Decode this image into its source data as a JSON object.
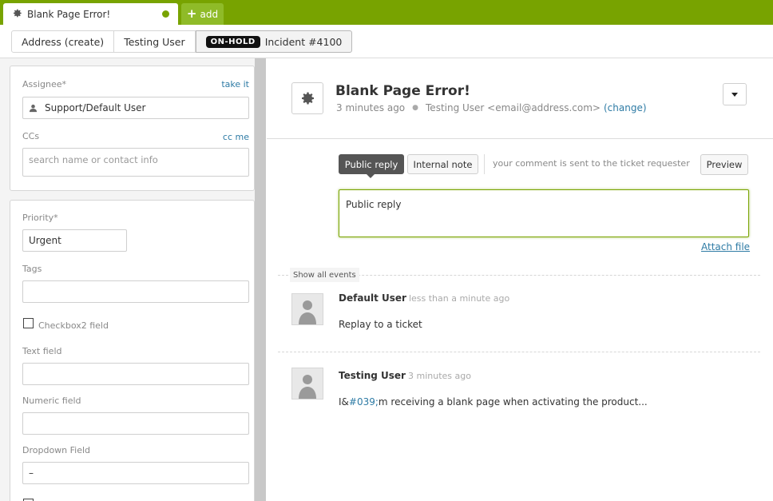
{
  "tabs": {
    "active_title": "Blank Page Error!",
    "add_label": "add"
  },
  "breadcrumb": {
    "items": [
      "Address (create)",
      "Testing User"
    ],
    "status": "ON-HOLD",
    "current": "Incident #4100"
  },
  "sidebar": {
    "assignee_label": "Assignee*",
    "take_it": "take it",
    "assignee_value": "Support/Default User",
    "ccs_label": "CCs",
    "cc_me": "cc me",
    "ccs_placeholder": "search name or contact info",
    "priority_label": "Priority*",
    "priority_value": "Urgent",
    "tags_label": "Tags",
    "checkbox2_label": "Checkbox2 field",
    "text_field_label": "Text field",
    "numeric_field_label": "Numeric field",
    "dropdown_label": "Dropdown Field",
    "dropdown_value": "–"
  },
  "ticket": {
    "title": "Blank Page Error!",
    "time": "3 minutes ago",
    "requester": "Testing User <email@address.com>",
    "change": "(change)"
  },
  "composer": {
    "public_reply": "Public reply",
    "internal_note": "Internal note",
    "hint": "your comment is sent to the ticket requester",
    "preview": "Preview",
    "comment_text": "Public reply",
    "attach_file": "Attach file"
  },
  "events": {
    "show_all": "Show all events",
    "items": [
      {
        "author": "Default User",
        "time": "less than a minute ago",
        "body": "Replay to a ticket"
      },
      {
        "author": "Testing User",
        "time": "3 minutes ago",
        "body_prefix": "I&",
        "body_link": "#039;",
        "body_suffix": "m receiving a blank page when activating the product..."
      }
    ]
  },
  "colors": {
    "brand": "#78a300",
    "link": "#2e7ba5"
  }
}
